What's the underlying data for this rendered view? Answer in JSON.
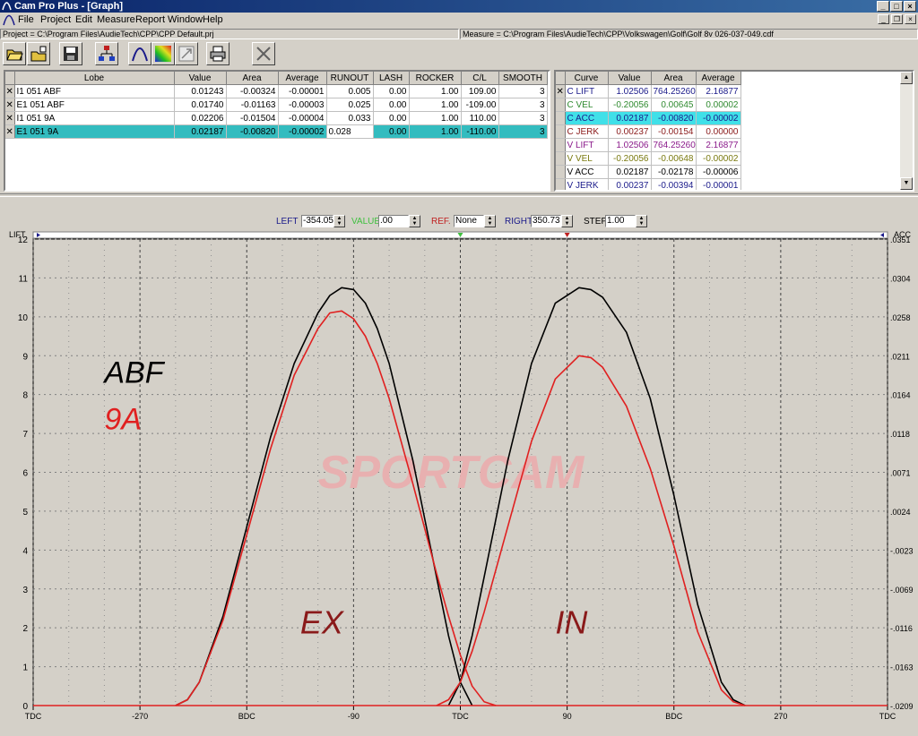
{
  "window": {
    "title": "Cam Pro Plus - [Graph]",
    "accent": "#0a246a"
  },
  "menu": [
    "File",
    "Project",
    "Edit",
    "Measure",
    "Report",
    "Window",
    "Help"
  ],
  "paths": {
    "project": "Project = C:\\Program Files\\AudieTech\\CPP\\CPP Default.prj",
    "measure": "Measure = C:\\Program Files\\AudieTech\\CPP\\Volkswagen\\Golf\\Golf 8v 026-037-049.cdf"
  },
  "toolbar": [
    "open-folder-icon",
    "open-file-icon",
    "save-icon",
    "network-icon",
    "cam-profile-icon",
    "color-palette-icon",
    "export-icon",
    "print-icon",
    "close-x-icon"
  ],
  "lobe_table": {
    "headers": [
      "Lobe",
      "Value",
      "Area",
      "Average",
      "RUNOUT",
      "LASH",
      "ROCKER",
      "C/L",
      "SMOOTH"
    ],
    "rows": [
      {
        "mark": "✕",
        "cells": [
          "I1 051 ABF",
          "0.01243",
          "-0.00324",
          "-0.00001",
          "0.005",
          "0.00",
          "1.00",
          "109.00",
          "3"
        ]
      },
      {
        "mark": "✕",
        "cells": [
          "E1 051 ABF",
          "0.01740",
          "-0.01163",
          "-0.00003",
          "0.025",
          "0.00",
          "1.00",
          "-109.00",
          "3"
        ]
      },
      {
        "mark": "✕",
        "cells": [
          "I1 051 9A",
          "0.02206",
          "-0.01504",
          "-0.00004",
          "0.033",
          "0.00",
          "1.00",
          "110.00",
          "3"
        ]
      },
      {
        "mark": "✕",
        "cells": [
          "E1 051 9A",
          "0.02187",
          "-0.00820",
          "-0.00002",
          "0.028",
          "0.00",
          "1.00",
          "-110.00",
          "3"
        ]
      }
    ]
  },
  "curve_table": {
    "headers": [
      "Curve",
      "Value",
      "Area",
      "Average"
    ],
    "rows": [
      {
        "mark": "✕",
        "color": "#1a1a8a",
        "cells": [
          "C LIFT",
          "1.02506",
          "764.25260",
          "2.16877"
        ]
      },
      {
        "mark": "",
        "color": "#2f8a2f",
        "cells": [
          "C VEL",
          "-0.20056",
          "0.00645",
          "0.00002"
        ]
      },
      {
        "mark": "",
        "color": "#1a1a8a",
        "cells": [
          "C ACC",
          "0.02187",
          "-0.00820",
          "-0.00002"
        ]
      },
      {
        "mark": "",
        "color": "#8a1a1a",
        "cells": [
          "C JERK",
          "0.00237",
          "-0.00154",
          "0.00000"
        ]
      },
      {
        "mark": "",
        "color": "#8a1a8a",
        "cells": [
          "V LIFT",
          "1.02506",
          "764.25260",
          "2.16877"
        ]
      },
      {
        "mark": "",
        "color": "#7a7a10",
        "cells": [
          "V VEL",
          "-0.20056",
          "-0.00648",
          "-0.00002"
        ]
      },
      {
        "mark": "",
        "color": "#000000",
        "cells": [
          "V ACC",
          "0.02187",
          "-0.02178",
          "-0.00006"
        ]
      },
      {
        "mark": "",
        "color": "#1a1a8a",
        "cells": [
          "V JERK",
          "0.00237",
          "-0.00394",
          "-0.00001"
        ]
      }
    ]
  },
  "controls": {
    "left_label": "LEFT",
    "left_value": "-354.05",
    "value_label": "VALUE",
    "value_value": ".00",
    "ref_label": "REF.",
    "ref_value": "None",
    "right_label": "RIGHT",
    "right_value": "350.73",
    "step_label": "STEP",
    "step_value": "1.00"
  },
  "chart_data": {
    "type": "line",
    "ylabel_left": "LIFT",
    "ylabel_right": "ACC",
    "xlim": [
      -360,
      360
    ],
    "ylim": [
      0,
      12
    ],
    "x_ticks": [
      {
        "x": -360,
        "label": "TDC"
      },
      {
        "x": -270,
        "label": "-270"
      },
      {
        "x": -180,
        "label": "BDC"
      },
      {
        "x": -90,
        "label": "-90"
      },
      {
        "x": 0,
        "label": "TDC"
      },
      {
        "x": 90,
        "label": "90"
      },
      {
        "x": 180,
        "label": "BDC"
      },
      {
        "x": 270,
        "label": "270"
      },
      {
        "x": 360,
        "label": "TDC"
      }
    ],
    "y_ticks": [
      0,
      1,
      2,
      3,
      4,
      5,
      6,
      7,
      8,
      9,
      10,
      11,
      12
    ],
    "y_right_ticks": [
      "-.0209",
      "-.0163",
      "-.0116",
      "-.0069",
      "-.0023",
      ".0024",
      ".0071",
      ".0118",
      ".0164",
      ".0211",
      ".0258",
      ".0304",
      ".0351"
    ],
    "grid": true,
    "series": [
      {
        "color": "#000000",
        "x": [
          -240,
          -230,
          -220,
          -200,
          -180,
          -160,
          -140,
          -120,
          -110,
          -100,
          -90,
          -80,
          -70,
          -60,
          -40,
          -20,
          -10,
          0,
          10
        ],
        "y": [
          0,
          0.15,
          0.6,
          2.3,
          4.6,
          6.9,
          8.8,
          10.1,
          10.55,
          10.75,
          10.7,
          10.35,
          9.7,
          8.8,
          6.3,
          3.3,
          1.8,
          0.6,
          0
        ]
      },
      {
        "color": "#e02020",
        "x": [
          -240,
          -230,
          -220,
          -200,
          -180,
          -160,
          -140,
          -120,
          -110,
          -100,
          -90,
          -80,
          -70,
          -60,
          -40,
          -20,
          -10,
          0,
          10,
          20,
          30
        ],
        "y": [
          0,
          0.15,
          0.6,
          2.2,
          4.4,
          6.6,
          8.5,
          9.7,
          10.1,
          10.15,
          9.95,
          9.5,
          8.8,
          7.9,
          5.7,
          3.4,
          2.3,
          1.3,
          0.5,
          0.1,
          0
        ]
      },
      {
        "color": "#000000",
        "x": [
          -10,
          0,
          10,
          20,
          40,
          60,
          80,
          100,
          110,
          120,
          140,
          160,
          180,
          200,
          220,
          230,
          240
        ],
        "y": [
          0,
          0.6,
          1.8,
          3.3,
          6.3,
          8.8,
          10.35,
          10.75,
          10.7,
          10.5,
          9.6,
          7.9,
          5.4,
          2.6,
          0.6,
          0.15,
          0
        ]
      },
      {
        "color": "#e02020",
        "x": [
          -20,
          -10,
          0,
          10,
          20,
          40,
          60,
          80,
          100,
          110,
          120,
          140,
          160,
          180,
          200,
          220,
          230,
          240
        ],
        "y": [
          0,
          0.15,
          0.6,
          1.4,
          2.4,
          4.6,
          6.8,
          8.4,
          9.0,
          8.95,
          8.7,
          7.7,
          6.1,
          4.1,
          1.9,
          0.4,
          0.1,
          0
        ]
      }
    ],
    "annotations": [
      {
        "text": "ABF",
        "x": -300,
        "y": 8.3,
        "color": "#000000",
        "size": 34
      },
      {
        "text": "9A",
        "x": -300,
        "y": 7.1,
        "color": "#e02020",
        "size": 34
      },
      {
        "text": "EX",
        "x": -135,
        "y": 1.85,
        "color": "#8a1a1a",
        "size": 36
      },
      {
        "text": "IN",
        "x": 80,
        "y": 1.85,
        "color": "#8a1a1a",
        "size": 36
      },
      {
        "text": "SPORTCAM",
        "x": -120,
        "y": 5.6,
        "color": "#e8b0b0",
        "size": 52
      }
    ]
  }
}
